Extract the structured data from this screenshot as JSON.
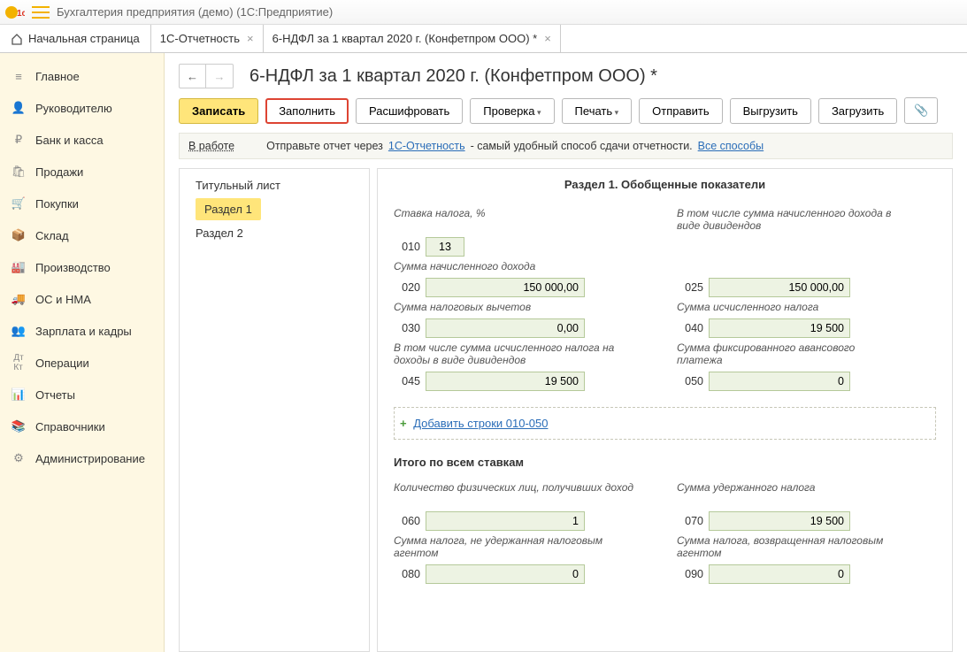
{
  "titlebar": {
    "text": "Бухгалтерия предприятия (демо)  (1С:Предприятие)"
  },
  "tabs": {
    "home": "Начальная страница",
    "items": [
      {
        "label": "1С-Отчетность"
      },
      {
        "label": "6-НДФЛ за 1 квартал 2020 г. (Конфетпром ООО) *"
      }
    ]
  },
  "sidebar": [
    {
      "icon": "menu",
      "label": "Главное"
    },
    {
      "icon": "user",
      "label": "Руководителю"
    },
    {
      "icon": "ruble",
      "label": "Банк и касса"
    },
    {
      "icon": "bag",
      "label": "Продажи"
    },
    {
      "icon": "cart",
      "label": "Покупки"
    },
    {
      "icon": "box",
      "label": "Склад"
    },
    {
      "icon": "factory",
      "label": "Производство"
    },
    {
      "icon": "truck",
      "label": "ОС и НМА"
    },
    {
      "icon": "person",
      "label": "Зарплата и кадры"
    },
    {
      "icon": "ops",
      "label": "Операции"
    },
    {
      "icon": "chart",
      "label": "Отчеты"
    },
    {
      "icon": "book",
      "label": "Справочники"
    },
    {
      "icon": "gear",
      "label": "Администрирование"
    }
  ],
  "doc": {
    "title": "6-НДФЛ за 1 квартал 2020 г. (Конфетпром ООО) *",
    "toolbar": {
      "write": "Записать",
      "fill": "Заполнить",
      "decode": "Расшифровать",
      "check": "Проверка",
      "print": "Печать",
      "send": "Отправить",
      "export": "Выгрузить",
      "import": "Загрузить"
    },
    "info": {
      "status": "В работе",
      "pre": "Отправьте отчет через ",
      "link1": "1С-Отчетность",
      "mid": " - самый удобный способ сдачи отчетности. ",
      "link2": "Все способы"
    },
    "sections": {
      "title_page": "Титульный лист",
      "sec1": "Раздел 1",
      "sec2": "Раздел 2"
    },
    "form": {
      "heading": "Раздел 1. Обобщенные показатели",
      "l010": "Ставка налога, %",
      "v010": "13",
      "l020": "Сумма начисленного дохода",
      "v020": "150 000,00",
      "l025a": "В том числе сумма начисленного дохода в виде дивидендов",
      "v025": "150 000,00",
      "l030": "Сумма налоговых вычетов",
      "v030": "0,00",
      "l040": "Сумма исчисленного налога",
      "v040": "19 500",
      "l045": "В том числе сумма исчисленного налога на доходы в виде дивидендов",
      "v045": "19 500",
      "l050": "Сумма фиксированного авансового платежа",
      "v050": "0",
      "add_rows": "Добавить строки 010-050",
      "subheading": "Итого по всем ставкам",
      "l060": "Количество физических лиц, получивших доход",
      "v060": "1",
      "l070": "Сумма удержанного налога",
      "v070": "19 500",
      "l080": "Сумма налога, не удержанная налоговым агентом",
      "v080": "0",
      "l090": "Сумма налога, возвращенная налоговым агентом",
      "v090": "0"
    },
    "codes": {
      "c010": "010",
      "c020": "020",
      "c025": "025",
      "c030": "030",
      "c040": "040",
      "c045": "045",
      "c050": "050",
      "c060": "060",
      "c070": "070",
      "c080": "080",
      "c090": "090"
    }
  }
}
